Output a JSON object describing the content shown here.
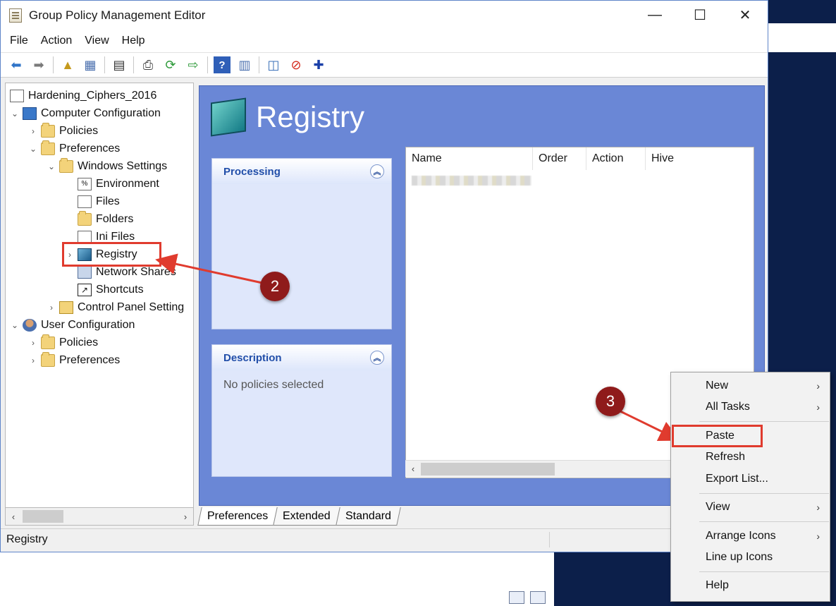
{
  "window": {
    "title": "Group Policy Management Editor",
    "controls": {
      "minimize": "—",
      "maximize": "☐",
      "close": "✕"
    }
  },
  "menu": [
    "File",
    "Action",
    "View",
    "Help"
  ],
  "tree": {
    "root": "Hardening_Ciphers_2016",
    "computer_config": "Computer Configuration",
    "policies": "Policies",
    "preferences": "Preferences",
    "windows_settings": "Windows Settings",
    "environment": "Environment",
    "files": "Files",
    "folders": "Folders",
    "ini_files": "Ini Files",
    "registry": "Registry",
    "network_shares": "Network Shares",
    "shortcuts": "Shortcuts",
    "control_panel": "Control Panel Setting",
    "user_config": "User Configuration",
    "user_policies": "Policies",
    "user_preferences": "Preferences"
  },
  "content": {
    "title": "Registry",
    "processing_title": "Processing",
    "description_title": "Description",
    "description_text": "No policies selected",
    "columns": [
      "Name",
      "Order",
      "Action",
      "Hive"
    ]
  },
  "tabs": [
    "Preferences",
    "Extended",
    "Standard"
  ],
  "status": {
    "text": "Registry"
  },
  "context_menu": {
    "new": "New",
    "all_tasks": "All Tasks",
    "paste": "Paste",
    "refresh": "Refresh",
    "export_list": "Export List...",
    "view": "View",
    "arrange_icons": "Arrange Icons",
    "line_up_icons": "Line up Icons",
    "help": "Help"
  },
  "callouts": {
    "step2": "2",
    "step3": "3"
  },
  "colors": {
    "accent": "#6a87d6",
    "highlight": "#e03b2e",
    "callout": "#8f1b1b"
  }
}
